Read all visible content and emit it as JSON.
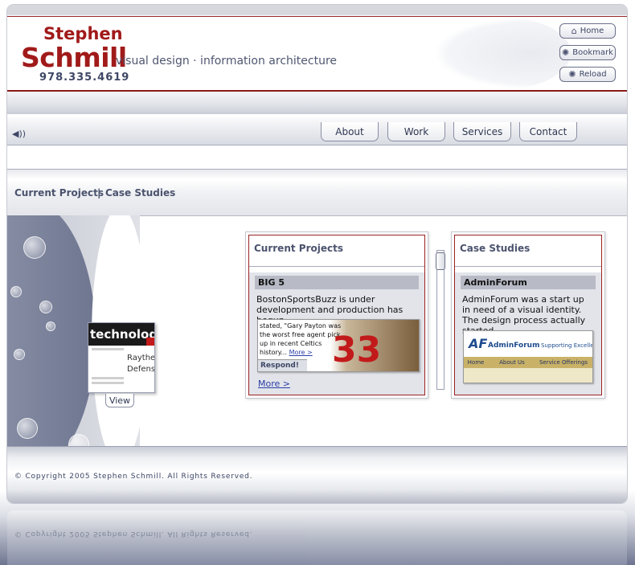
{
  "header": {
    "first_name": "Stephen",
    "last_name": "Schmill",
    "tagline": "visual design · information architecture",
    "phone": "978.335.4619",
    "buttons": [
      {
        "label": "Home",
        "icon": "home-icon"
      },
      {
        "label": "Bookmark",
        "icon": "gear-icon"
      },
      {
        "label": "Reload",
        "icon": "gear-icon"
      }
    ]
  },
  "nav": {
    "sound_icon": "speaker-icon",
    "tabs": [
      "About",
      "Work",
      "Services",
      "Contact"
    ]
  },
  "breadcrumb": {
    "item1": "Current Projects",
    "separator": "|",
    "item2": "Case Studies"
  },
  "thumbnail": {
    "header_text": "technology",
    "title_line1": "Raytheo",
    "title_line2": "Defense",
    "view_label": "View"
  },
  "current_projects": {
    "title": "Current Projects",
    "project_title": "BIG 5",
    "description": "BostonSportsBuzz is under development and production has begun.",
    "shot_text": "stated, \"Gary Payton was the worst free agent pick up in recent Celtics history...",
    "shot_more": "More >",
    "shot_number": "33",
    "shot_respond": "Respond!",
    "more_link": "More >"
  },
  "case_studies": {
    "title": "Case Studies",
    "project_title": "AdminForum",
    "description": "AdminForum was a start up in need of a visual identity. The design process actually started",
    "shot_logo_mark": "AF",
    "shot_logo_text": "AdminForum",
    "shot_tagline": "Supporting Excelle",
    "shot_nav": [
      "Home",
      "About Us",
      "Service Offerings"
    ]
  },
  "footer": {
    "copyright": "© Copyright 2005 Stephen Schmill. All Rights Reserved."
  },
  "colors": {
    "brand_red": "#a11a1a",
    "text_slate": "#4b536e",
    "link_blue": "#2a3ea8"
  }
}
